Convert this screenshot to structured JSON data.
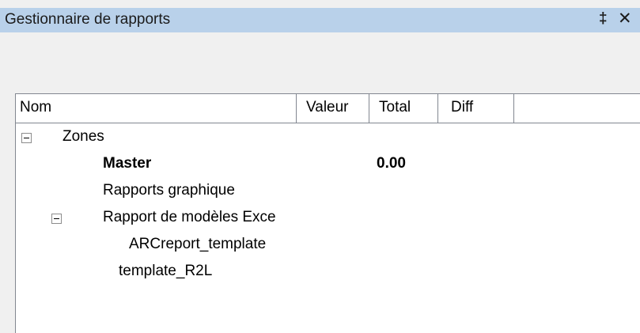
{
  "panel": {
    "title": "Gestionnaire de rapports",
    "pin_symbol": "‡",
    "close_symbol": "✕"
  },
  "columns": {
    "nom": "Nom",
    "valeur": "Valeur",
    "total": "Total",
    "diff": "Diff"
  },
  "tree": {
    "zones": {
      "label": "Zones",
      "expanded": true,
      "icon": "collapse-icon"
    },
    "master": {
      "label": "Master",
      "total": "0.00"
    },
    "rapports_graphique": {
      "label": "Rapports graphique"
    },
    "rapport_modeles": {
      "label": "Rapport de modèles Exce",
      "expanded": true,
      "icon": "collapse-icon"
    },
    "arc_template": {
      "label": "ARCreport_template"
    },
    "template_r2l": {
      "label": "template_R2L"
    }
  }
}
